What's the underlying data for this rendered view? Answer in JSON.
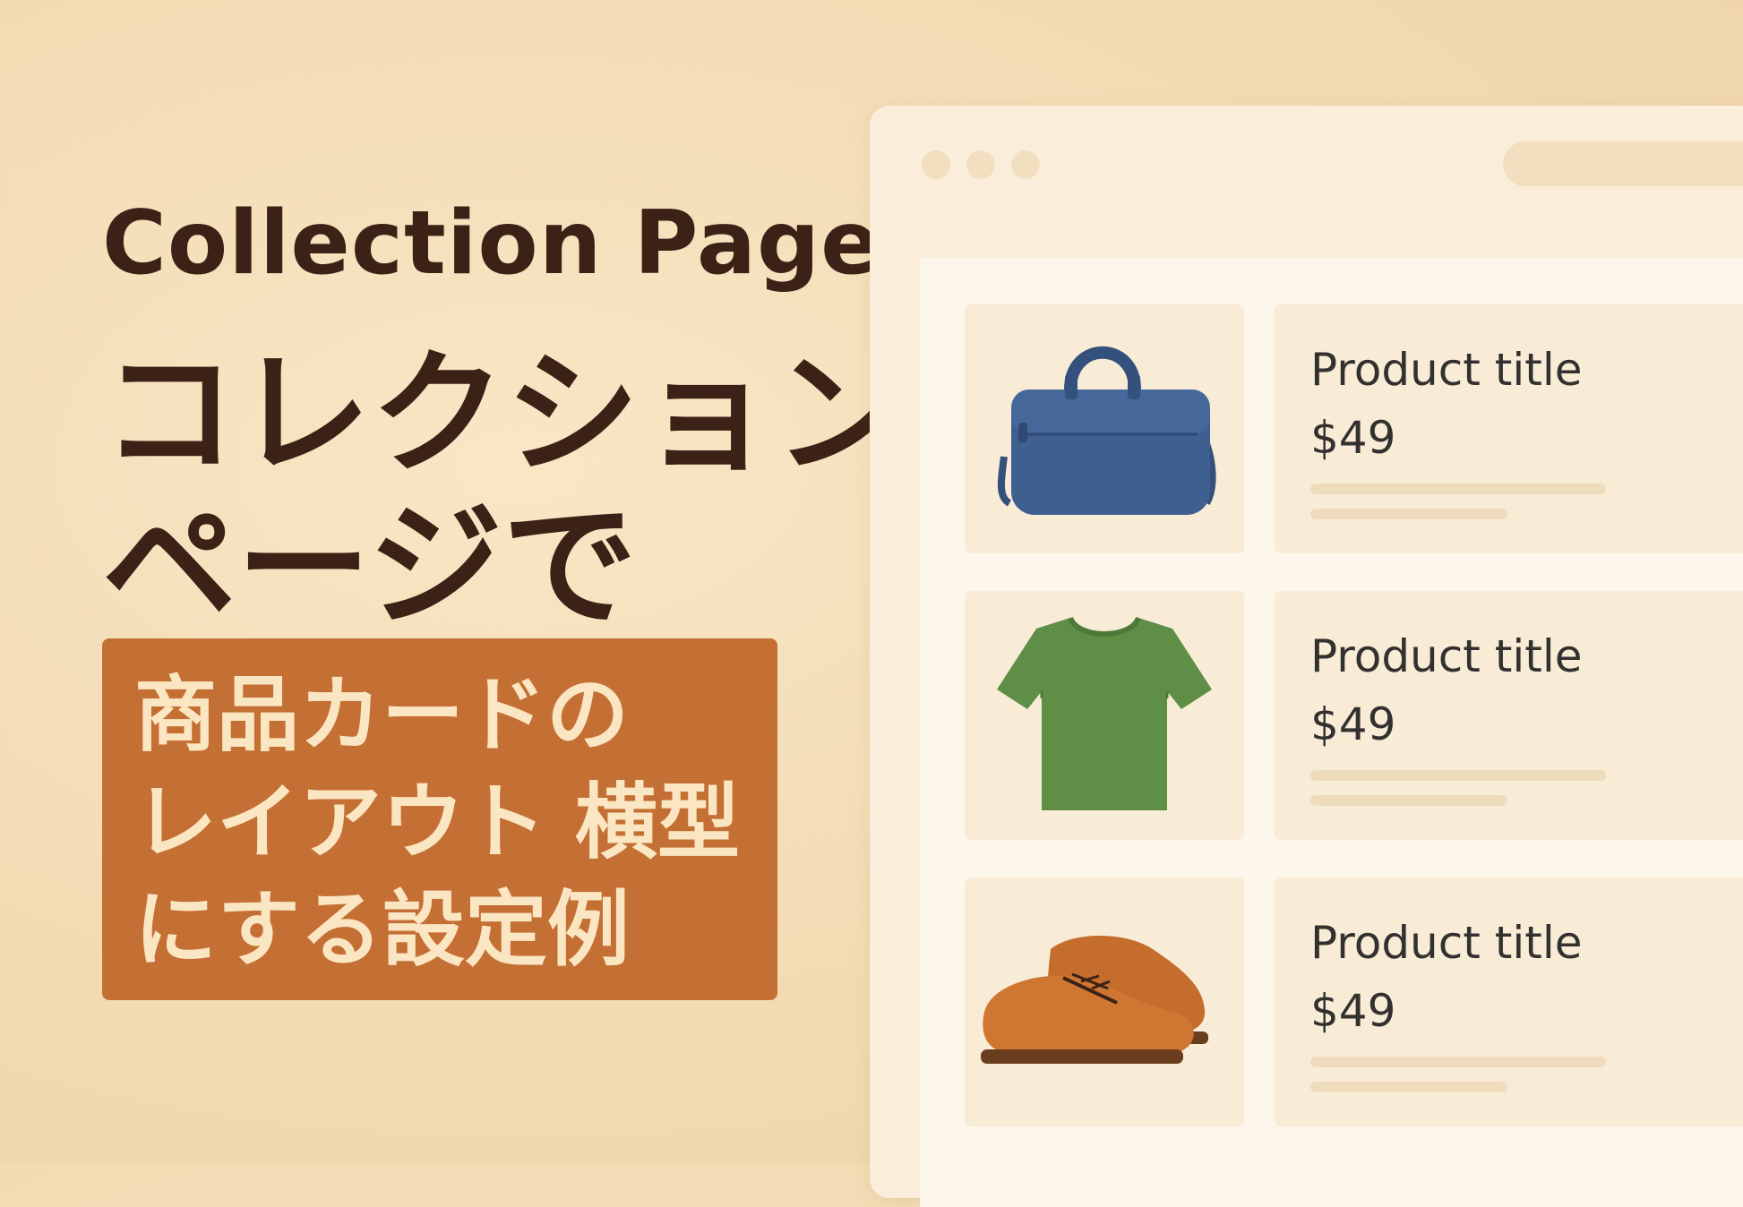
{
  "hero": {
    "title_en": "Collection Page",
    "title_ja_line1": "コレクション",
    "title_ja_line2": "ページで",
    "subtitle_lines": [
      "商品カードの",
      "レイアウト 横型",
      "にする設定例"
    ]
  },
  "browser": {
    "products": [
      {
        "image_icon": "bag-icon",
        "title": "Product title",
        "price": "$49"
      },
      {
        "image_icon": "tshirt-icon",
        "title": "Product title",
        "price": "$49"
      },
      {
        "image_icon": "shoes-icon",
        "title": "Product title",
        "price": "$49"
      }
    ]
  },
  "colors": {
    "background": "#f3ddb6",
    "heading": "#3b2116",
    "accent": "#c46f33",
    "accent_text": "#fbe6c3",
    "bag": "#3f5f90",
    "tshirt": "#5f8f46",
    "shoes": "#c46d2c"
  }
}
